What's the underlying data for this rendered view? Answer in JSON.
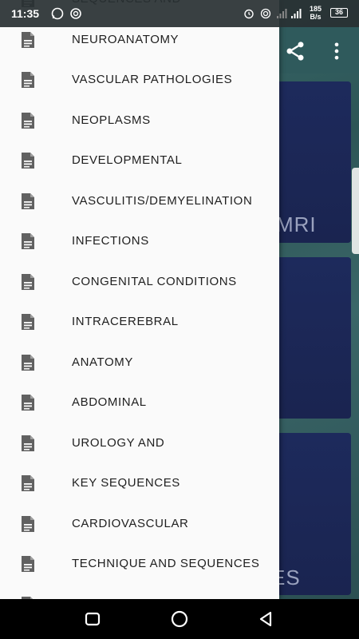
{
  "status_bar": {
    "time": "11:35",
    "net_speed_value": "185",
    "net_speed_unit": "B/s",
    "battery": "36"
  },
  "background": {
    "card_1_text": "MRI",
    "card_3_text": "ES"
  },
  "drawer": {
    "items": [
      {
        "label": "SEQUENCES AND",
        "icon": "document-icon"
      },
      {
        "label": "NEUROANATOMY",
        "icon": "document-icon"
      },
      {
        "label": "VASCULAR PATHOLOGIES",
        "icon": "document-icon"
      },
      {
        "label": "NEOPLASMS",
        "icon": "document-icon"
      },
      {
        "label": "DEVELOPMENTAL",
        "icon": "document-icon"
      },
      {
        "label": "VASCULITIS/DEMYELINATION",
        "icon": "document-icon"
      },
      {
        "label": "INFECTIONS",
        "icon": "document-icon"
      },
      {
        "label": "CONGENITAL CONDITIONS",
        "icon": "document-icon"
      },
      {
        "label": "INTRACEREBRAL",
        "icon": "document-icon"
      },
      {
        "label": "ANATOMY",
        "icon": "document-icon"
      },
      {
        "label": "ABDOMINAL",
        "icon": "document-icon"
      },
      {
        "label": "UROLOGY AND",
        "icon": "document-icon"
      },
      {
        "label": "KEY SEQUENCES",
        "icon": "document-icon"
      },
      {
        "label": "CARDIOVASCULAR",
        "icon": "document-icon"
      },
      {
        "label": "TECHNIQUE AND SEQUENCES",
        "icon": "document-icon"
      },
      {
        "label": "",
        "icon": "document-icon"
      }
    ]
  },
  "colors": {
    "drawer_bg": "#fafafa",
    "label_text": "#1f1f1f",
    "icon_gray": "#616161",
    "card_bg": "#1d2a5c"
  }
}
